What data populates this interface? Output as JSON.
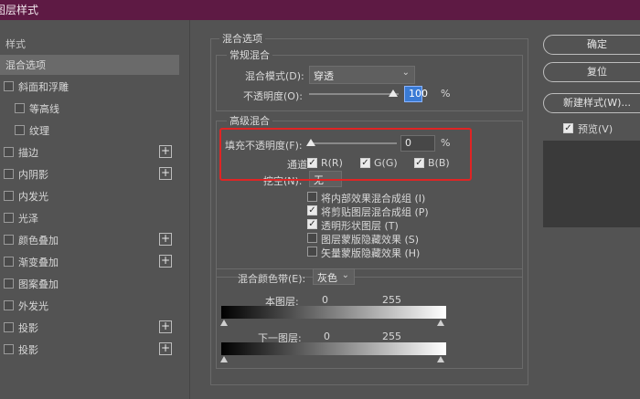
{
  "window": {
    "title": "图层样式"
  },
  "styles_panel": {
    "header": "样式",
    "items": [
      {
        "label": "混合选项",
        "checkbox": false,
        "plus": false,
        "selected": true,
        "indent": 0
      },
      {
        "label": "斜面和浮雕",
        "checkbox": true,
        "plus": false,
        "selected": false,
        "indent": 0
      },
      {
        "label": "等高线",
        "checkbox": true,
        "plus": false,
        "selected": false,
        "indent": 1
      },
      {
        "label": "纹理",
        "checkbox": true,
        "plus": false,
        "selected": false,
        "indent": 1
      },
      {
        "label": "描边",
        "checkbox": true,
        "plus": true,
        "selected": false,
        "indent": 0
      },
      {
        "label": "内阴影",
        "checkbox": true,
        "plus": true,
        "selected": false,
        "indent": 0
      },
      {
        "label": "内发光",
        "checkbox": true,
        "plus": false,
        "selected": false,
        "indent": 0
      },
      {
        "label": "光泽",
        "checkbox": true,
        "plus": false,
        "selected": false,
        "indent": 0
      },
      {
        "label": "颜色叠加",
        "checkbox": true,
        "plus": true,
        "selected": false,
        "indent": 0
      },
      {
        "label": "渐变叠加",
        "checkbox": true,
        "plus": true,
        "selected": false,
        "indent": 0
      },
      {
        "label": "图案叠加",
        "checkbox": true,
        "plus": false,
        "selected": false,
        "indent": 0
      },
      {
        "label": "外发光",
        "checkbox": true,
        "plus": false,
        "selected": false,
        "indent": 0
      },
      {
        "label": "投影",
        "checkbox": true,
        "plus": true,
        "selected": false,
        "indent": 0
      },
      {
        "label": "投影",
        "checkbox": true,
        "plus": true,
        "selected": false,
        "indent": 0
      }
    ]
  },
  "blend_options": {
    "title": "混合选项",
    "general": {
      "title": "常规混合",
      "mode_label": "混合模式(D):",
      "mode_value": "穿透",
      "opacity_label": "不透明度(O):",
      "opacity_value": "100",
      "opacity_unit": "%"
    },
    "advanced": {
      "title": "高级混合",
      "fill_label": "填充不透明度(F):",
      "fill_value": "0",
      "fill_unit": "%",
      "channels_label": "通道:",
      "channel_r": "R(R)",
      "channel_g": "G(G)",
      "channel_b": "B(B)",
      "knockout_label": "挖空(N):",
      "knockout_value": "无",
      "options": [
        {
          "label": "将内部效果混合成组 (I)",
          "checked": false
        },
        {
          "label": "将剪贴图层混合成组 (P)",
          "checked": true
        },
        {
          "label": "透明形状图层 (T)",
          "checked": true
        },
        {
          "label": "图层蒙版隐藏效果 (S)",
          "checked": false
        },
        {
          "label": "矢量蒙版隐藏效果 (H)",
          "checked": false
        }
      ]
    },
    "blend_if": {
      "label": "混合颜色带(E):",
      "value": "灰色",
      "this_layer": "本图层:",
      "this_min": "0",
      "this_max": "255",
      "underlying": "下一图层:",
      "under_min": "0",
      "under_max": "255"
    }
  },
  "right_panel": {
    "ok": "确定",
    "reset": "复位",
    "new_style": "新建样式(W)...",
    "preview_label": "预览(V)",
    "preview_checked": true
  },
  "colors": {
    "titlebar": "#5e1a44",
    "highlight": "#e02424",
    "focus": "#3a7bd5"
  }
}
